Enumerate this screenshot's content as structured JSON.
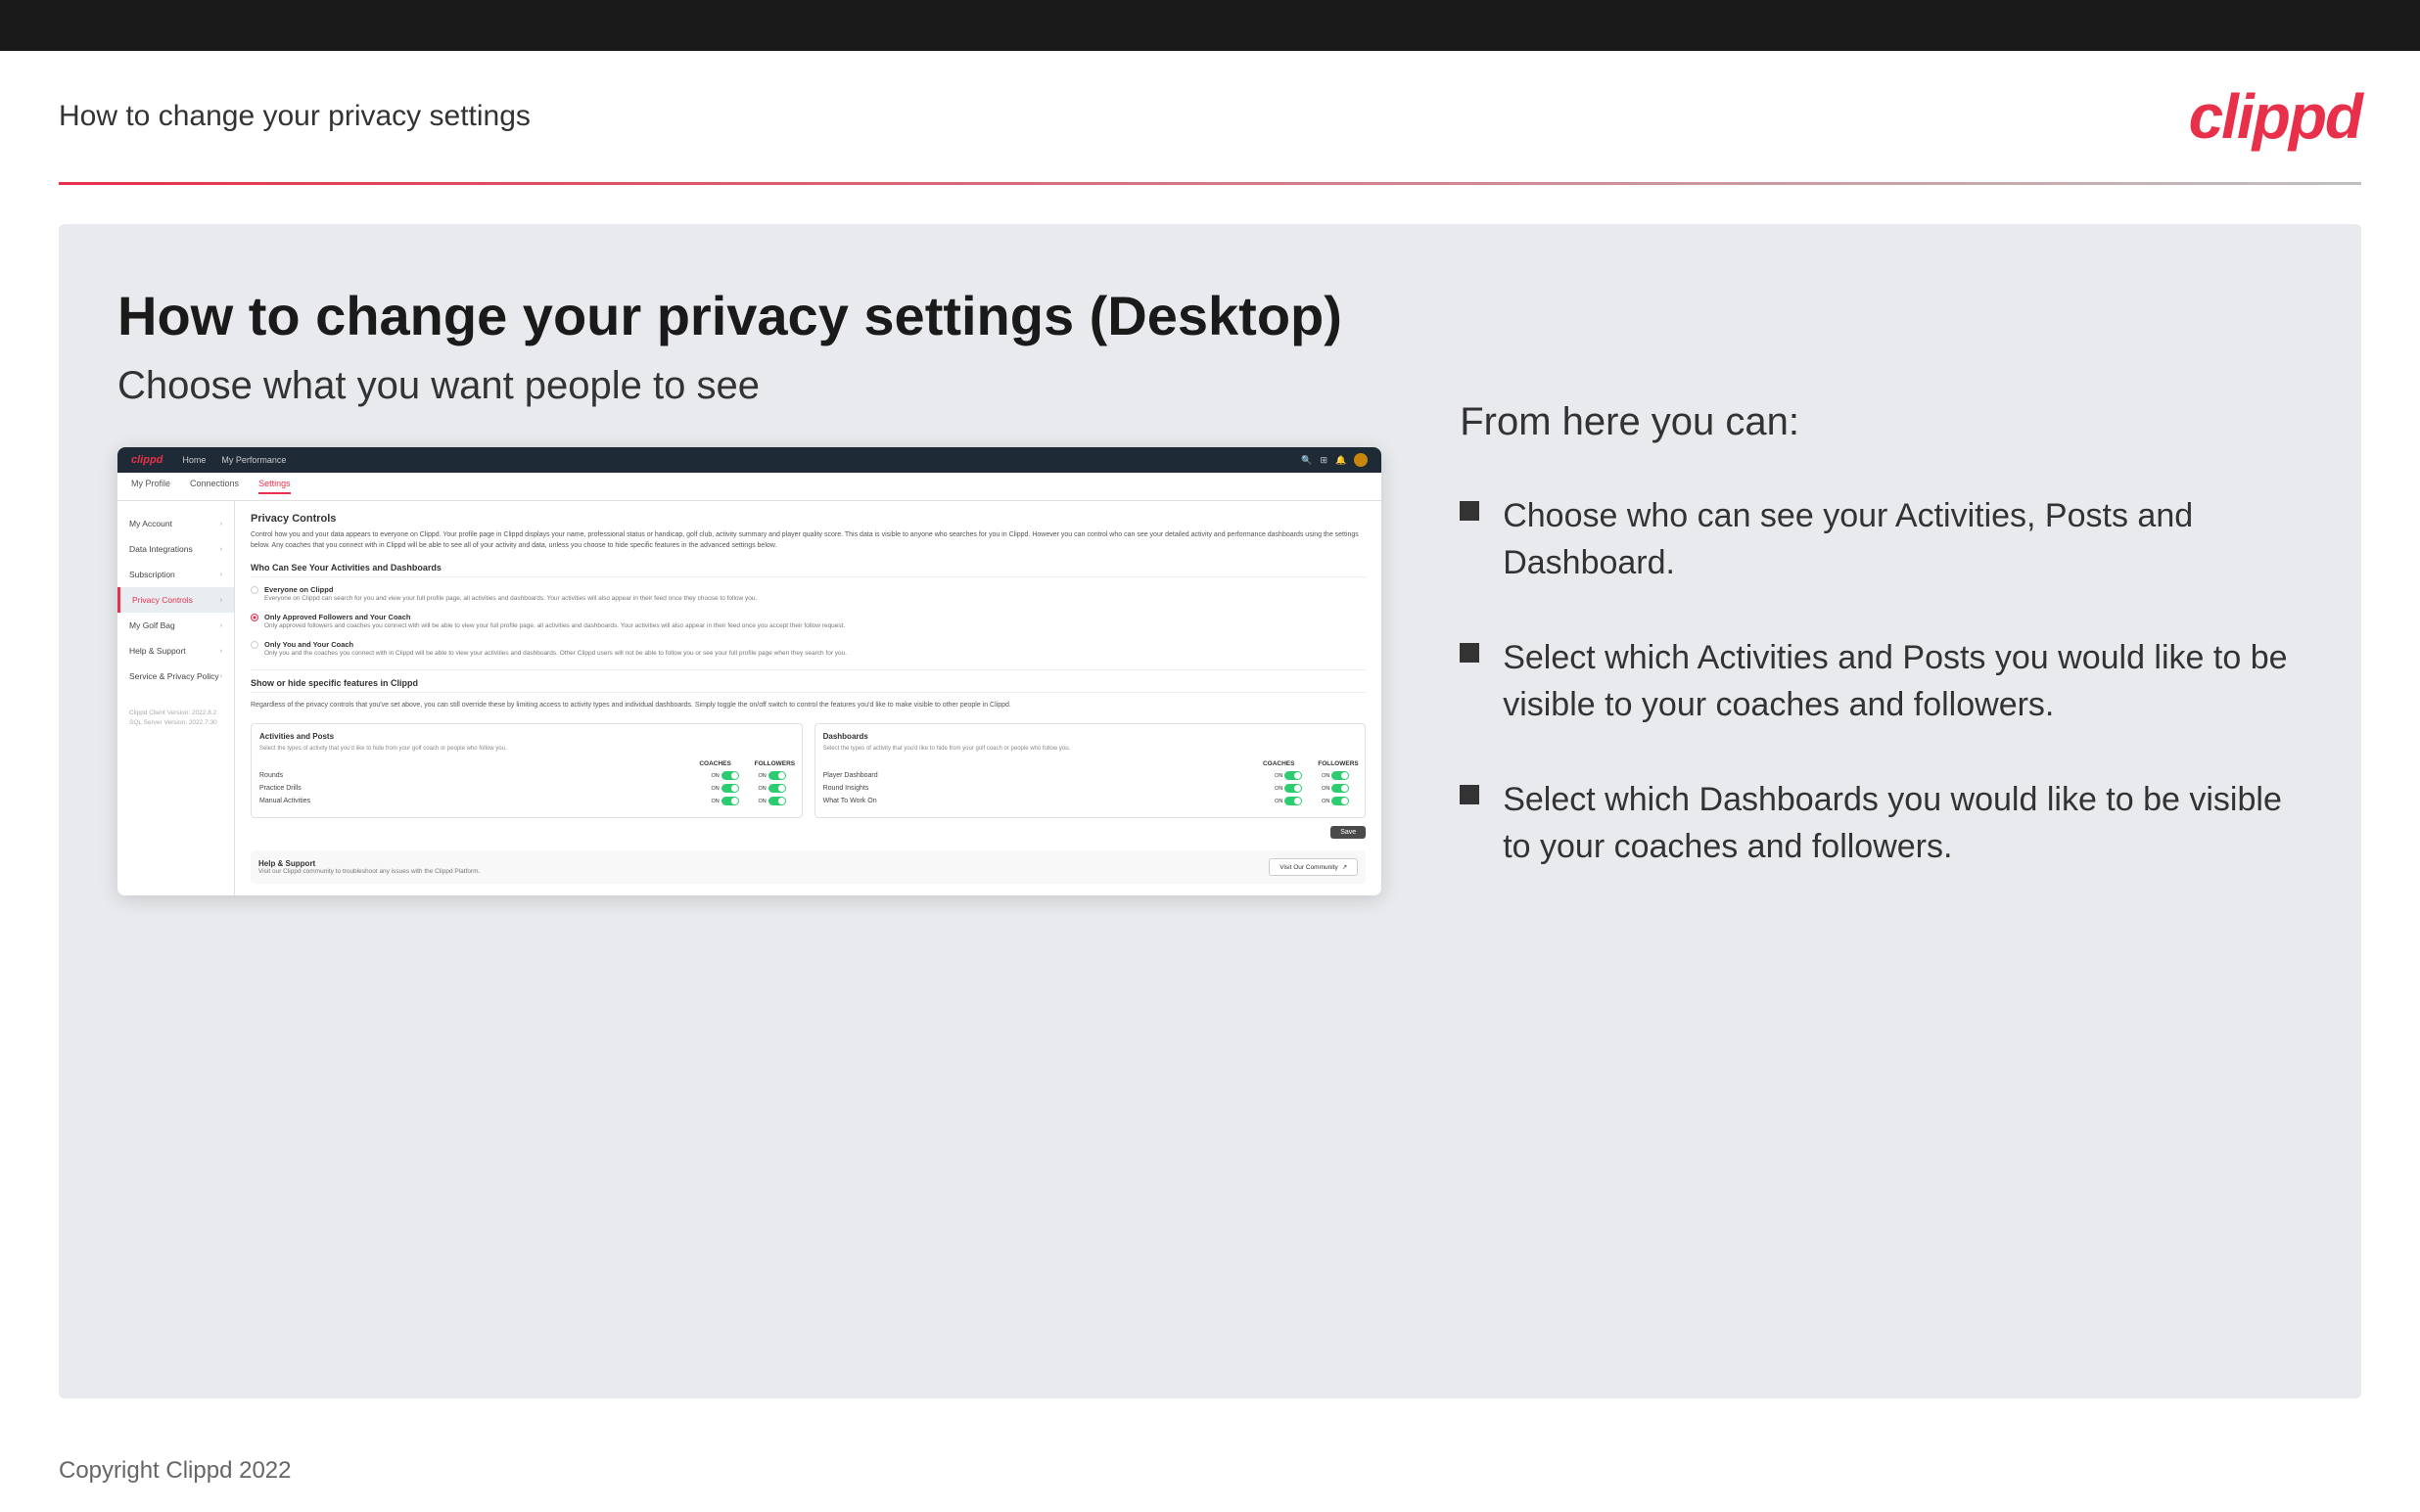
{
  "topBar": {},
  "header": {
    "title": "How to change your privacy settings",
    "logo": "clippd"
  },
  "main": {
    "heading": "How to change your privacy settings (Desktop)",
    "subheading": "Choose what you want people to see",
    "appMockup": {
      "nav": {
        "logo": "clippd",
        "links": [
          "Home",
          "My Performance"
        ],
        "icons": [
          "search",
          "grid",
          "bell",
          "user"
        ]
      },
      "subnav": [
        "My Profile",
        "Connections",
        "Settings"
      ],
      "sidebar": {
        "items": [
          {
            "label": "My Account",
            "active": false
          },
          {
            "label": "Data Integrations",
            "active": false
          },
          {
            "label": "Subscription",
            "active": false
          },
          {
            "label": "Privacy Controls",
            "active": true
          },
          {
            "label": "My Golf Bag",
            "active": false
          },
          {
            "label": "Help & Support",
            "active": false
          },
          {
            "label": "Service & Privacy Policy",
            "active": false
          }
        ],
        "version": "Clippd Client Version: 2022.8.2\nSQL Server Version: 2022.7.30"
      },
      "panel": {
        "title": "Privacy Controls",
        "description": "Control how you and your data appears to everyone on Clippd. Your profile page in Clippd displays your name, professional status or handicap, golf club, activity summary and player quality score. This data is visible to anyone who searches for you in Clippd. However you can control who can see your detailed activity and performance dashboards using the settings below. Any coaches that you connect with in Clippd will be able to see all of your activity and data, unless you choose to hide specific features in the advanced settings below.",
        "whoCanSee": {
          "title": "Who Can See Your Activities and Dashboards",
          "options": [
            {
              "id": "everyone",
              "label": "Everyone on Clippd",
              "description": "Everyone on Clippd can search for you and view your full profile page, all activities and dashboards. Your activities will also appear in their feed once they choose to follow you.",
              "selected": false
            },
            {
              "id": "followers",
              "label": "Only Approved Followers and Your Coach",
              "description": "Only approved followers and coaches you connect with will be able to view your full profile page, all activities and dashboards. Your activities will also appear in their feed once you accept their follow request.",
              "selected": true
            },
            {
              "id": "coach",
              "label": "Only You and Your Coach",
              "description": "Only you and the coaches you connect with in Clippd will be able to view your activities and dashboards. Other Clippd users will not be able to follow you or see your full profile page when they search for you.",
              "selected": false
            }
          ]
        },
        "showHide": {
          "sectionTitle": "Show or hide specific features in Clippd",
          "description": "Regardless of the privacy controls that you've set above, you can still override these by limiting access to activity types and individual dashboards. Simply toggle the on/off switch to control the features you'd like to make visible to other people in Clippd.",
          "activitiesAndPosts": {
            "title": "Activities and Posts",
            "description": "Select the types of activity that you'd like to hide from your golf coach or people who follow you.",
            "headers": [
              "COACHES",
              "FOLLOWERS"
            ],
            "rows": [
              {
                "label": "Rounds",
                "coaches": "ON",
                "followers": "ON"
              },
              {
                "label": "Practice Drills",
                "coaches": "ON",
                "followers": "ON"
              },
              {
                "label": "Manual Activities",
                "coaches": "ON",
                "followers": "ON"
              }
            ]
          },
          "dashboards": {
            "title": "Dashboards",
            "description": "Select the types of activity that you'd like to hide from your golf coach or people who follow you.",
            "headers": [
              "COACHES",
              "FOLLOWERS"
            ],
            "rows": [
              {
                "label": "Player Dashboard",
                "coaches": "ON",
                "followers": "ON"
              },
              {
                "label": "Round Insights",
                "coaches": "ON",
                "followers": "ON"
              },
              {
                "label": "What To Work On",
                "coaches": "ON",
                "followers": "ON"
              }
            ]
          }
        },
        "saveButton": "Save",
        "helpSection": {
          "title": "Help & Support",
          "description": "Visit our Clippd community to troubleshoot any issues with the Clippd Platform.",
          "buttonLabel": "Visit Our Community"
        }
      }
    },
    "rightSide": {
      "fromHereTitle": "From here you can:",
      "bullets": [
        "Choose who can see your Activities, Posts and Dashboard.",
        "Select which Activities and Posts you would like to be visible to your coaches and followers.",
        "Select which Dashboards you would like to be visible to your coaches and followers."
      ]
    }
  },
  "footer": {
    "copyright": "Copyright Clippd 2022"
  }
}
